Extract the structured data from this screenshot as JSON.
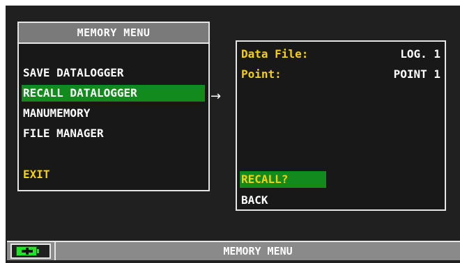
{
  "left_panel": {
    "title": "MEMORY MENU",
    "items": [
      {
        "label": "SAVE DATALOGGER",
        "selected": false
      },
      {
        "label": "RECALL DATALOGGER",
        "selected": true
      },
      {
        "label": "MANUMEMORY",
        "selected": false
      },
      {
        "label": "FILE MANAGER",
        "selected": false
      }
    ],
    "exit_label": "EXIT"
  },
  "arrow": "→",
  "right_panel": {
    "fields": [
      {
        "label": "Data File:",
        "value": "LOG. 1"
      },
      {
        "label": "Point:",
        "value": "POINT 1"
      }
    ],
    "recall_label": "RECALL?",
    "back_label": "BACK"
  },
  "status_bar": {
    "title": "MEMORY MENU",
    "battery_icon": "battery-charging-icon"
  },
  "colors": {
    "background": "#202020",
    "panel_border": "#e6e6e6",
    "highlight": "#138a1d",
    "accent_yellow": "#f5d10a",
    "title_bar": "#7a7a7a",
    "battery": "#22e32a"
  }
}
